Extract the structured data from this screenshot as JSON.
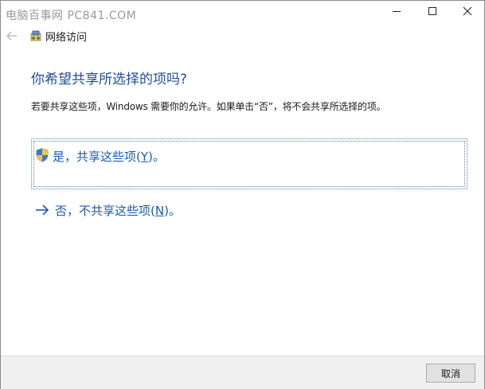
{
  "watermark": "电脑百事网 PC841.COM",
  "window": {
    "title": "网络访问"
  },
  "main": {
    "heading": "你希望共享所选择的项吗?",
    "description": "若要共享这些项，Windows 需要你的允许。如果单击“否”，将不会共享所选择的项。"
  },
  "options": {
    "yes": {
      "label_prefix": "是，共享这些项(",
      "label_key": "Y",
      "label_suffix": ")。"
    },
    "no": {
      "label_prefix": "否，不共享这些项(",
      "label_key": "N",
      "label_suffix": ")。"
    }
  },
  "footer": {
    "cancel_label": "取消"
  },
  "icons": {
    "back": "back-arrow-icon",
    "minimize": "minimize-icon",
    "maximize": "maximize-icon",
    "close": "close-icon",
    "wizard": "network-wizard-icon",
    "shield": "uac-shield-icon",
    "arrow": "right-arrow-icon"
  },
  "colors": {
    "heading": "#1f4e99",
    "link": "#1c5bb0",
    "focus_border": "#9fc3e6",
    "footer_bg": "#f0f0f0"
  }
}
